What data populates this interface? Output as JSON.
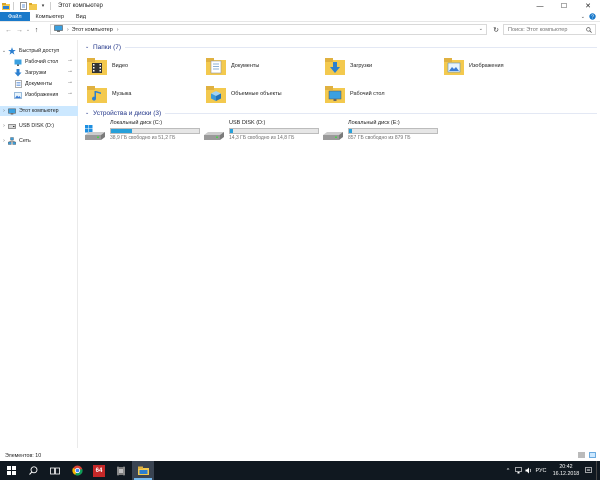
{
  "window": {
    "title": "Этот компьютер",
    "controls": {
      "minimize": "—",
      "maximize": "☐",
      "close": "✕"
    }
  },
  "ribbon": {
    "tabs": [
      "Файл",
      "Компьютер",
      "Вид"
    ]
  },
  "address": {
    "path": "Этот компьютер",
    "search_placeholder": "Поиск: Этот компьютер"
  },
  "navpane": {
    "quick_access": "Быстрый доступ",
    "quick_items": [
      "Рабочий стол",
      "Загрузки",
      "Документы",
      "Изображения"
    ],
    "this_pc": "Этот компьютер",
    "usb": "USB DISK (D:)",
    "network": "Сеть"
  },
  "folders_group": {
    "title": "Папки (7)",
    "items": [
      "Видео",
      "Документы",
      "Загрузки",
      "Изображения",
      "Музыка",
      "Объемные объекты",
      "Рабочий стол"
    ]
  },
  "drives_group": {
    "title": "Устройства и диски (3)",
    "items": [
      {
        "name": "Локальный диск (C:)",
        "free": "38,9 ГБ свободно из 51,2 ГБ",
        "used_fraction": 0.24
      },
      {
        "name": "USB DISK (D:)",
        "free": "14,3 ГБ свободно из 14,8 ГБ",
        "used_fraction": 0.03
      },
      {
        "name": "Локальный диск (E:)",
        "free": "857 ГБ свободно из 879 ГБ",
        "used_fraction": 0.03
      }
    ]
  },
  "status": {
    "items_count": "Элементов: 10"
  },
  "taskbar": {
    "app_64": "64",
    "language": "РУС",
    "time": "20:42",
    "date": "16.12.2018"
  },
  "colors": {
    "accent": "#1979ca",
    "drive_bar": "#26a0da",
    "group_header": "#1e3287",
    "selection": "#cce8ff",
    "taskbar": "#101820"
  }
}
